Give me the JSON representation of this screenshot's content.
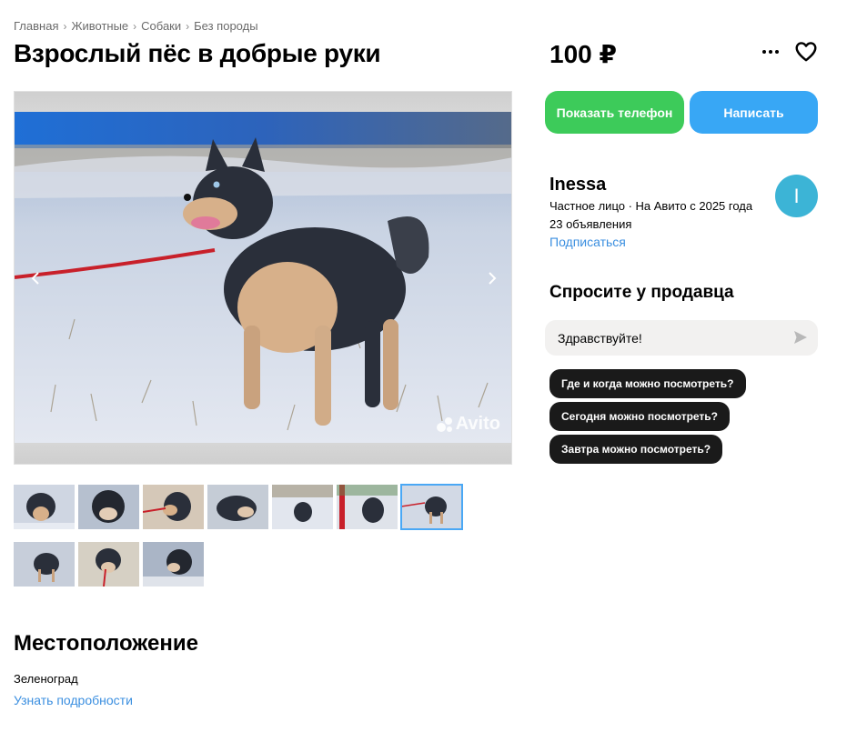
{
  "breadcrumb": [
    "Главная",
    "Животные",
    "Собаки",
    "Без породы"
  ],
  "listing": {
    "title": "Взрослый пёс в добрые руки",
    "price": "100 ₽"
  },
  "icons": {
    "more": "more-dots-icon",
    "favorite": "heart-icon",
    "prev": "chevron-left-icon",
    "next": "chevron-right-icon",
    "send": "send-icon"
  },
  "gallery": {
    "watermark": "Avito",
    "thumbnail_count": 10,
    "active_thumbnail": 7
  },
  "actions": {
    "phone_label": "Показать телефон",
    "write_label": "Написать"
  },
  "seller": {
    "name": "Inessa",
    "avatar_letter": "I",
    "info": "Частное лицо · На Авито с 2025 года",
    "ads": "23 объявления",
    "subscribe": "Подписаться"
  },
  "ask": {
    "title": "Спросите у продавца",
    "message": "Здравствуйте!",
    "quick_questions": [
      "Где и когда можно посмотреть?",
      "Сегодня можно посмотреть?",
      "Завтра можно посмотреть?"
    ]
  },
  "location": {
    "title": "Местоположение",
    "city": "Зеленоград",
    "details_link": "Узнать подробности"
  },
  "colors": {
    "green": "#3dcb5a",
    "blue": "#38a7f5",
    "link": "#3b8fe0",
    "avatar": "#3cb4d6"
  }
}
